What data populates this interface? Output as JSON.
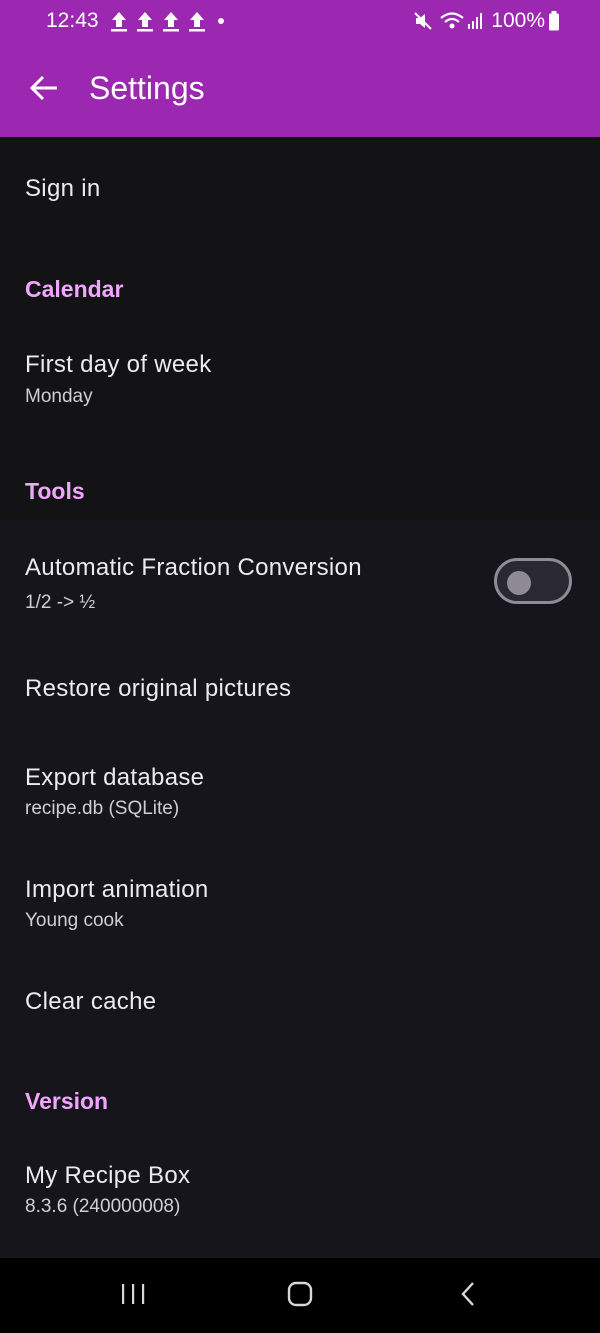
{
  "status_bar": {
    "time": "12:43",
    "battery": "100%",
    "icons": [
      "upload-icon",
      "upload-icon",
      "upload-icon",
      "upload-icon",
      "notification-dot-icon",
      "mute-icon",
      "wifi-icon",
      "signal-icon",
      "battery-icon"
    ]
  },
  "app_bar": {
    "title": "Settings",
    "back_icon": "arrow-back-icon",
    "color": "#9c27b0"
  },
  "settings": {
    "sign_in": {
      "title": "Sign in"
    },
    "calendar": {
      "header": "Calendar",
      "first_day": {
        "title": "First day of week",
        "value": "Monday"
      }
    },
    "tools": {
      "header": "Tools",
      "fraction": {
        "title": "Automatic Fraction Conversion",
        "value": "1/2 -> ½",
        "enabled": false
      },
      "restore": {
        "title": "Restore original pictures"
      },
      "export": {
        "title": "Export database",
        "value": "recipe.db (SQLite)"
      },
      "import_anim": {
        "title": "Import animation",
        "value": "Young cook"
      },
      "clear_cache": {
        "title": "Clear cache"
      }
    },
    "version": {
      "header": "Version",
      "app": {
        "title": "My Recipe Box",
        "value": "8.3.6 (240000008)"
      }
    }
  },
  "nav_bar": {
    "icons": [
      "recent-apps-icon",
      "home-icon",
      "back-icon"
    ]
  },
  "colors": {
    "accent": "#f1a6ff",
    "background": "#151419"
  }
}
